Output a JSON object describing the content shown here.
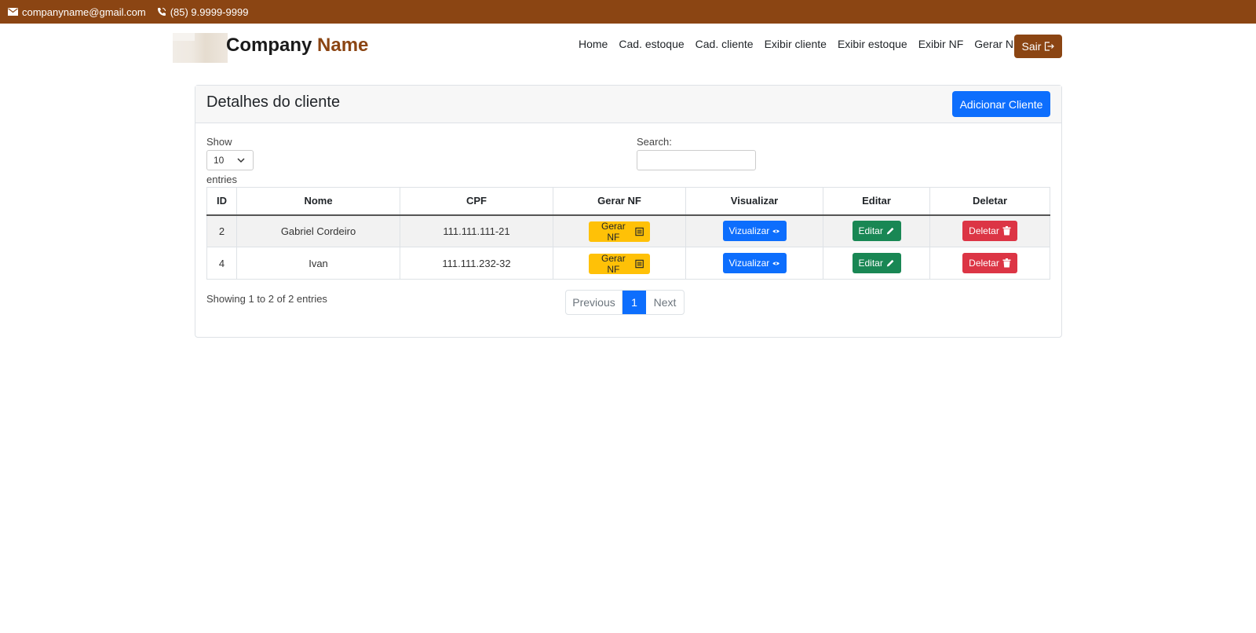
{
  "topbar": {
    "email": "companyname@gmail.com",
    "phone": "(85) 9.9999-9999"
  },
  "brand": {
    "name_part1": "Company",
    "name_part2": "Name",
    "accent_color": "#8b4513"
  },
  "nav": {
    "items": [
      {
        "label": "Home"
      },
      {
        "label": "Cad. estoque"
      },
      {
        "label": "Cad. cliente"
      },
      {
        "label": "Exibir cliente"
      },
      {
        "label": "Exibir estoque"
      },
      {
        "label": "Exibir NF"
      },
      {
        "label": "Gerar NF"
      }
    ],
    "logout_label": "Sair"
  },
  "card": {
    "title": "Detalhes do cliente",
    "add_button": "Adicionar Cliente"
  },
  "table_controls": {
    "show_label": "Show",
    "length_value": "10",
    "entries_label": "entries",
    "search_label": "Search:",
    "search_value": ""
  },
  "table": {
    "headers": [
      "ID",
      "Nome",
      "CPF",
      "Gerar NF",
      "Visualizar",
      "Editar",
      "Deletar"
    ],
    "rows": [
      {
        "id": "2",
        "nome": "Gabriel Cordeiro",
        "cpf": "111.111.111-21",
        "gerar": "Gerar NF",
        "ver": "Vizualizar",
        "editar": "Editar",
        "deletar": "Deletar"
      },
      {
        "id": "4",
        "nome": "Ivan",
        "cpf": "111.111.232-32",
        "gerar": "Gerar NF",
        "ver": "Vizualizar",
        "editar": "Editar",
        "deletar": "Deletar"
      }
    ]
  },
  "footer": {
    "info": "Showing 1 to 2 of 2 entries",
    "prev": "Previous",
    "current_page": "1",
    "next": "Next"
  },
  "colors": {
    "topbar": "#8b4513",
    "primary": "#0d6efd",
    "warning": "#ffc107",
    "success": "#198754",
    "danger": "#dc3545"
  }
}
